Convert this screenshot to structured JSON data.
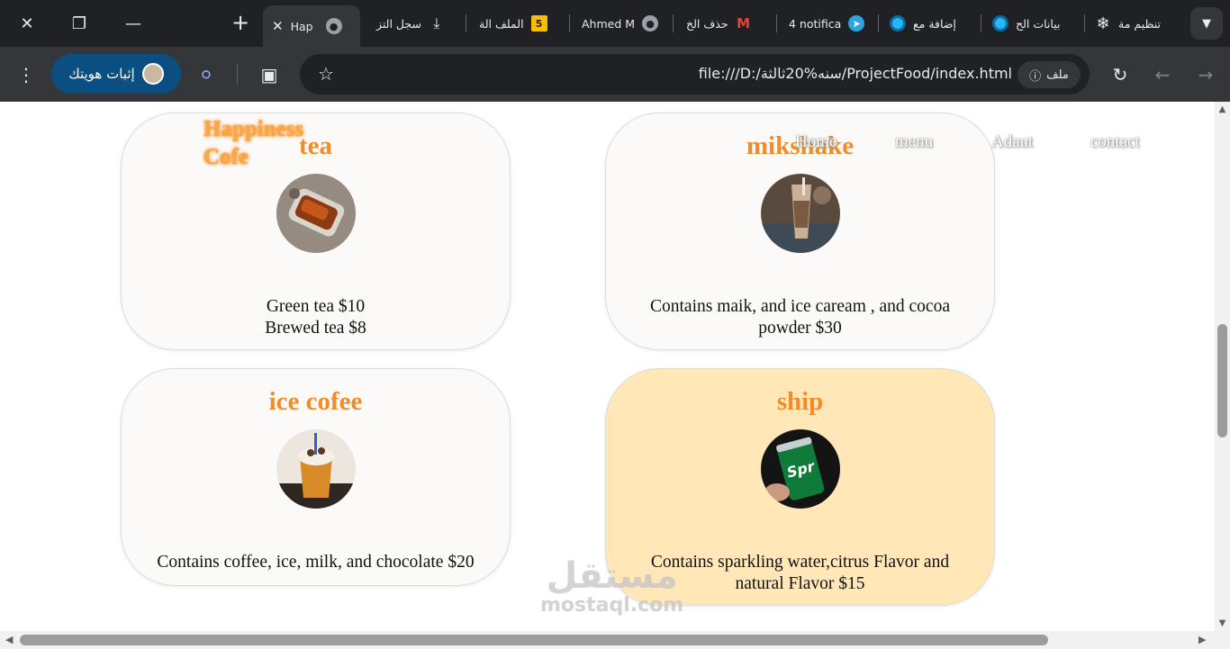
{
  "browser": {
    "tabs": [
      {
        "title": "تنظيم مة",
        "icon": "chatgpt-icon"
      },
      {
        "title": "بيانات الح",
        "icon": "blue-circle-icon"
      },
      {
        "title": "إضافة مع",
        "icon": "blue-circle-icon"
      },
      {
        "title": "4 notifica",
        "icon": "telegram-icon"
      },
      {
        "title": "حذف الخ",
        "icon": "gmail-icon"
      },
      {
        "title": "Ahmed M",
        "icon": "globe-icon"
      },
      {
        "title": "الملف الة",
        "icon": "number-five-icon",
        "badge": "5"
      },
      {
        "title": "سجل التز",
        "icon": "download-icon"
      },
      {
        "title": "Hap",
        "icon": "globe-icon",
        "active": true
      }
    ],
    "address": {
      "url": "file:///D:/سنه%20ثالثة/ProjectFood/index.html",
      "chip_label": "ملف"
    },
    "verify_label": "إثبات هويتك"
  },
  "page": {
    "brand": {
      "line1": "Happiness",
      "line2": "Cofe"
    },
    "nav": [
      "Home",
      "menu",
      "Adaut",
      "contact"
    ],
    "cards": [
      {
        "title": "tea",
        "desc_line1": "Green tea $10",
        "desc_line2": "Brewed tea $8"
      },
      {
        "title": "mikshake",
        "desc_line1": "Contains maik, and ice caream , and cocoa",
        "desc_line2": "powder $30"
      },
      {
        "title": "ice cofee",
        "desc_line1": "Contains coffee, ice, milk, and chocolate $20",
        "desc_line2": ""
      },
      {
        "title": "ship",
        "desc_line1": "Contains sparkling water,citrus Flavor and",
        "desc_line2": "natural Flavor $15",
        "highlight_color": "#ffe7b8"
      }
    ],
    "watermark": {
      "arabic": "مستقل",
      "latin": "mostaql.com"
    }
  },
  "colors": {
    "accent_orange": "#f28c28",
    "chrome_dark": "#202124",
    "chrome_toolbar": "#35363a",
    "verify_blue": "#0b4f82"
  }
}
